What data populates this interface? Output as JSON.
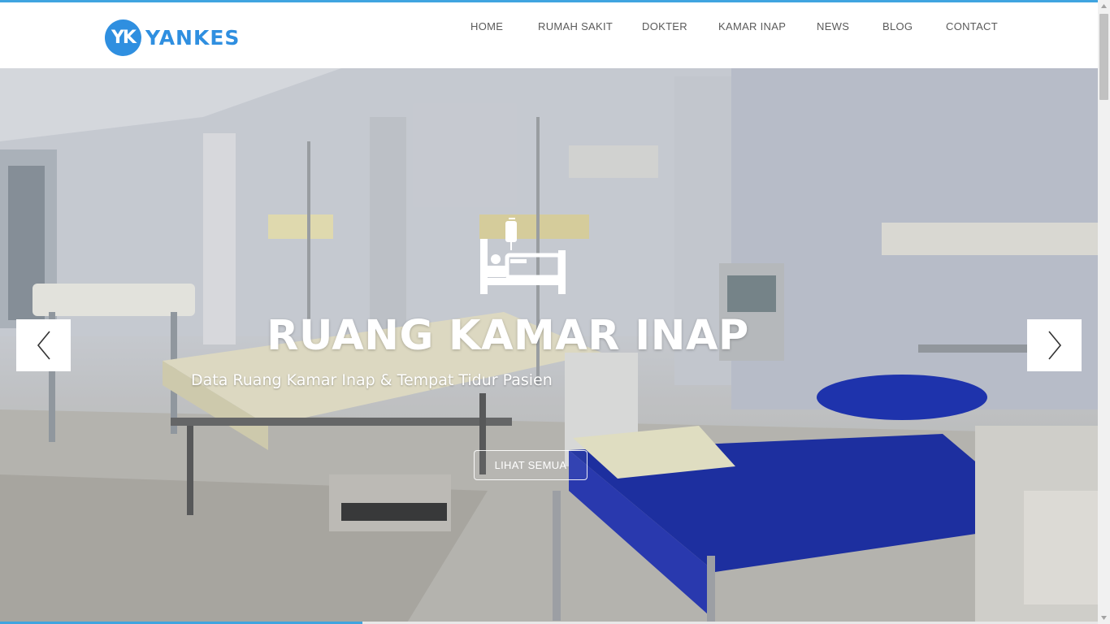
{
  "brand": {
    "logo_mark": "YK",
    "name": "YANKES",
    "color": "#2f8fe0"
  },
  "nav": {
    "items": [
      {
        "label": "HOME"
      },
      {
        "label": "RUMAH SAKIT"
      },
      {
        "label": "DOKTER"
      },
      {
        "label": "KAMAR INAP"
      },
      {
        "label": "NEWS"
      },
      {
        "label": "BLOG"
      },
      {
        "label": "CONTACT"
      }
    ]
  },
  "hero": {
    "icon": "hospital-bed-icon",
    "title": "RUANG KAMAR INAP",
    "subtitle": "Data Ruang Kamar Inap & Tempat Tidur Pasien",
    "button_label": "LIHAT SEMUA",
    "prev_icon": "chevron-left-icon",
    "next_icon": "chevron-right-icon",
    "progress": 0.33
  },
  "colors": {
    "accent": "#3fa4e0",
    "nav_text": "#5a5a5a"
  }
}
